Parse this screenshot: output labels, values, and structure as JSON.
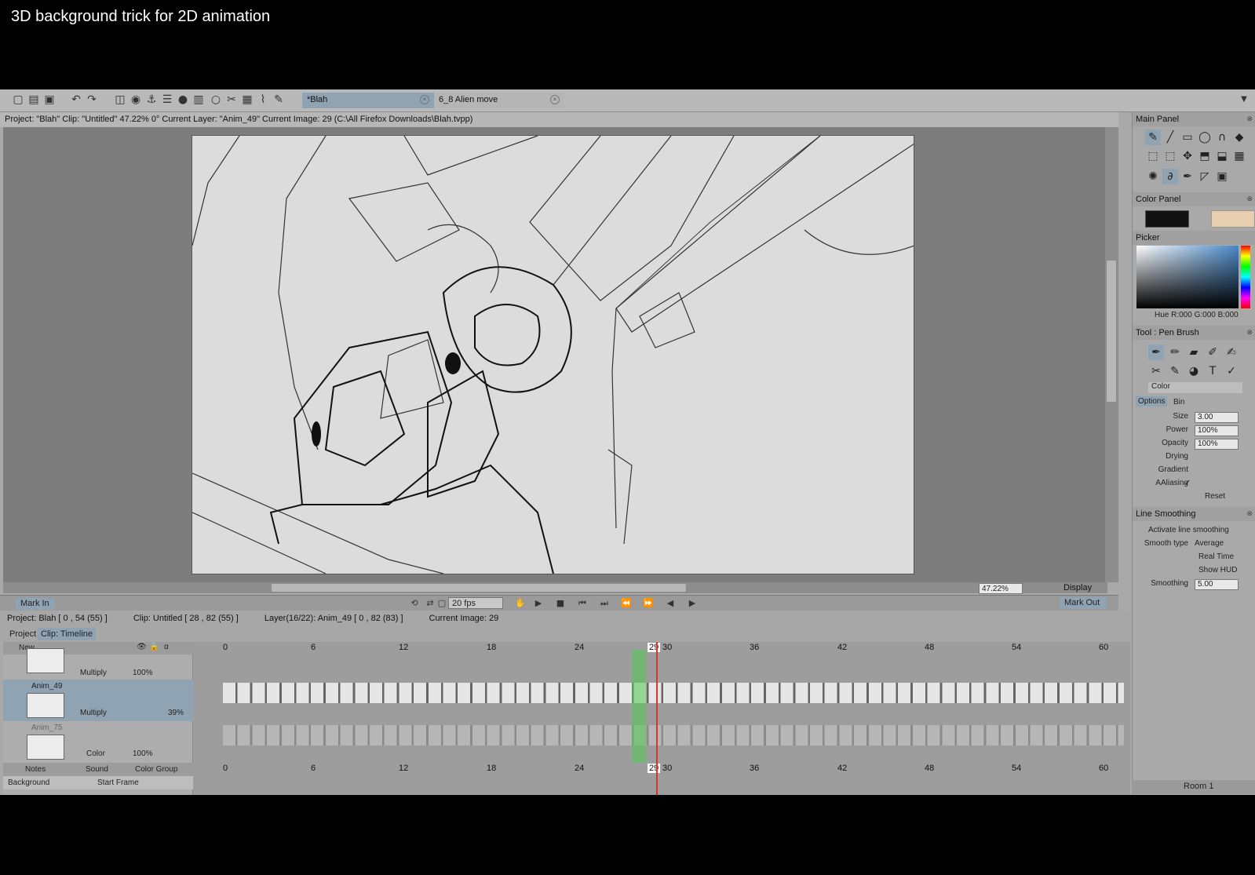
{
  "video_title": "3D background trick for 2D animation",
  "tabs": [
    {
      "label": "*Blah"
    },
    {
      "label": "6_8 Alien move"
    }
  ],
  "info_bar": "Project: \"Blah\"  Clip: \"Untitled\"   47.22%   0°  Current Layer: \"Anim_49\"  Current Image: 29 (C:\\All Firefox Downloads\\Blah.tvpp)",
  "viewport": {
    "zoom": "47.22%",
    "display_label": "Display"
  },
  "playbar": {
    "mark_in": "Mark In",
    "fps": "20 fps",
    "mark_out": "Mark Out"
  },
  "timeline_info": {
    "project": "Project: Blah [ 0 , 54  (55) ]",
    "clip": "Clip: Untitled [ 28 , 82  (55) ]",
    "layer": "Layer(16/22): Anim_49 [ 0 , 82  (83) ]",
    "current_image": "Current Image: 29"
  },
  "timeline_tabs": {
    "project": "Project",
    "clip_timeline": "Clip: Timeline"
  },
  "layers": {
    "new_label": "New",
    "top_blend": "Multiply",
    "top_opacity": "100%",
    "anim49_name": "Anim_49",
    "anim49_blend": "Multiply",
    "anim49_opacity": "39%",
    "anim75_name": "Anim_75",
    "anim75_blend": "Color",
    "anim75_opacity": "100%",
    "notes": "Notes",
    "sound": "Sound",
    "color_group": "Color Group",
    "background": "Background",
    "start_frame": "Start Frame"
  },
  "ruler_numbers": [
    "0",
    "6",
    "12",
    "18",
    "24",
    "29",
    "30",
    "36",
    "42",
    "48",
    "54",
    "60"
  ],
  "current_frame": "29",
  "right_panel": {
    "main_panel": "Main Panel",
    "color_panel": "Color Panel",
    "picker": "Picker",
    "picker_readout": "Hue R:000 G:000 B:000",
    "tool_title": "Tool : Pen Brush",
    "color_mode": "Color",
    "options_tab": "Options",
    "bin_tab": "Bin",
    "size_label": "Size",
    "size_value": "3.00",
    "power_label": "Power",
    "power_value": "100%",
    "opacity_label": "Opacity",
    "opacity_value": "100%",
    "drying_label": "Drying",
    "gradient_label": "Gradient",
    "aaliasing_label": "AAliasing",
    "reset": "Reset",
    "line_smoothing": "Line Smoothing",
    "activate_smoothing": "Activate line smoothing",
    "smooth_type_label": "Smooth type",
    "smooth_type_value": "Average",
    "real_time": "Real Time",
    "show_hud": "Show HUD",
    "smoothing_label": "Smoothing",
    "smoothing_value": "5.00",
    "room": "Room 1"
  },
  "colors": {
    "fg_swatch": "#111111",
    "bg_swatch": "#e7cfae",
    "accent": "#8fa3b3",
    "playhead": "#dd3333"
  }
}
